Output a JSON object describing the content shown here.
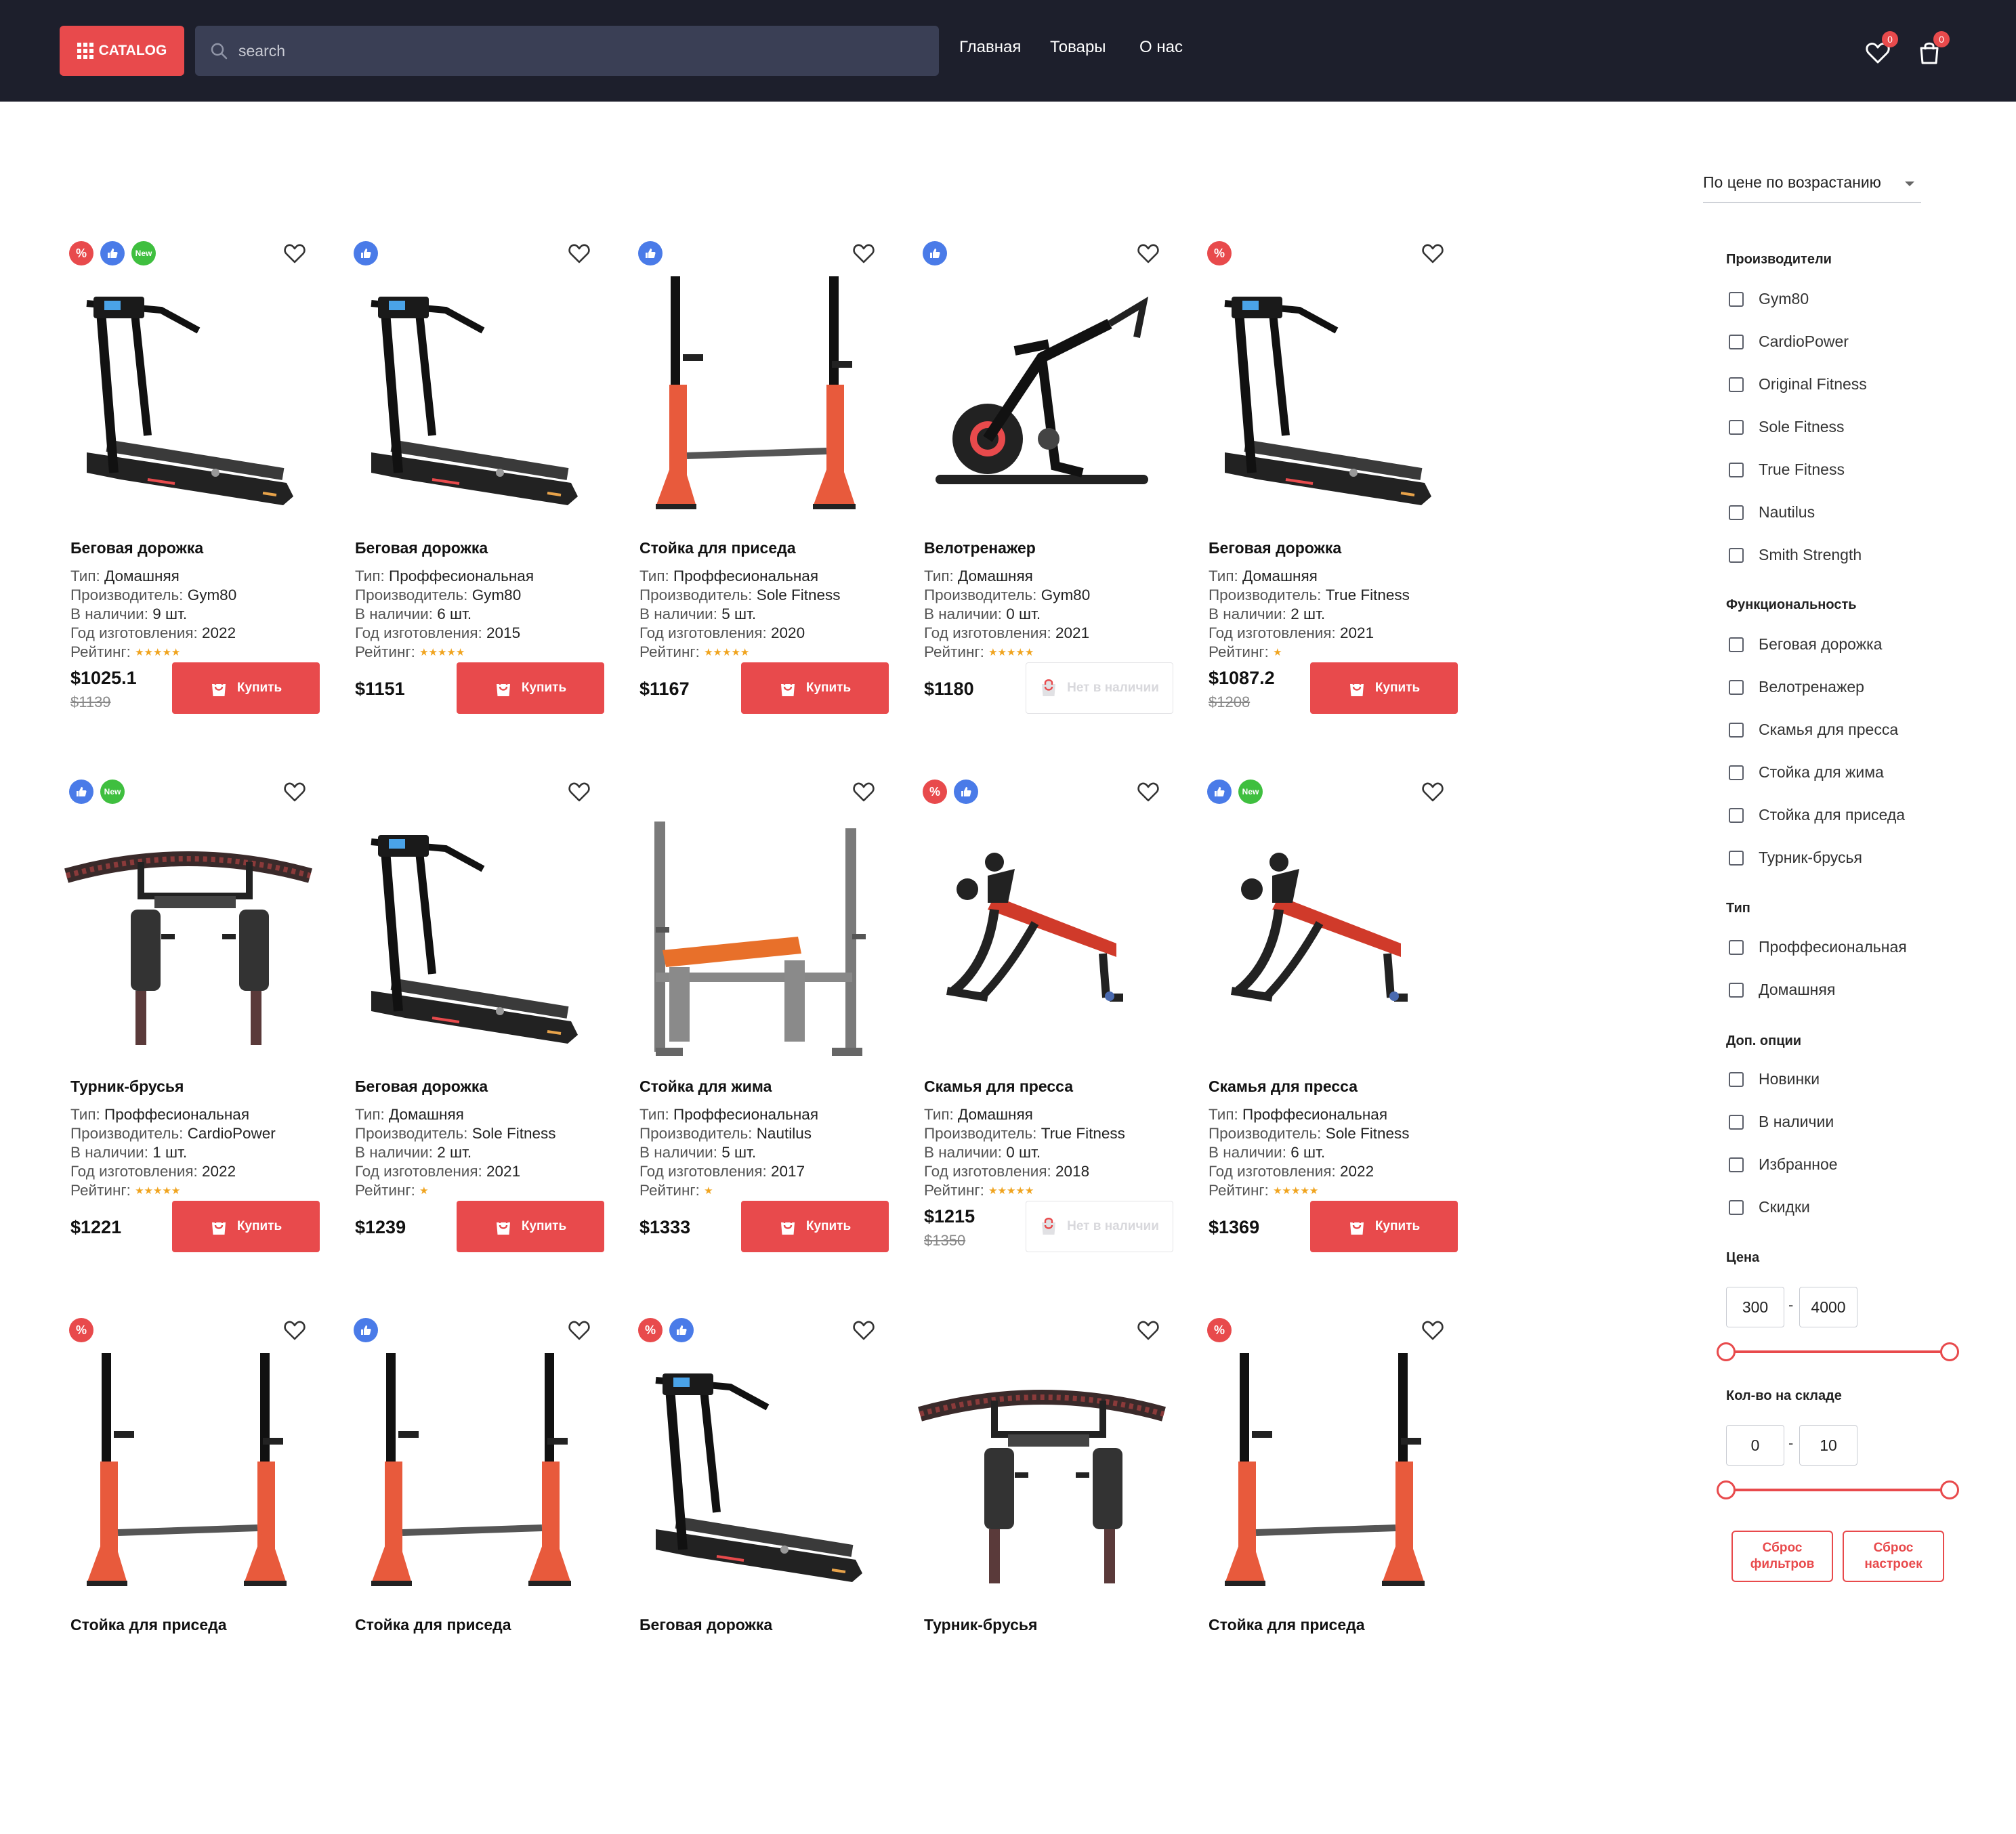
{
  "header": {
    "catalog_label": "CATALOG",
    "search_placeholder": "search",
    "nav": [
      "Главная",
      "Товары",
      "О нас"
    ],
    "favorites_count": "0",
    "cart_count": "0"
  },
  "sort": {
    "label": "По цене по возрастанию"
  },
  "filters": {
    "manufacturers_title": "Производители",
    "manufacturers": [
      "Gym80",
      "CardioPower",
      "Original Fitness",
      "Sole Fitness",
      "True Fitness",
      "Nautilus",
      "Smith Strength"
    ],
    "function_title": "Функциональность",
    "functions": [
      "Беговая дорожка",
      "Велотренажер",
      "Скамья для пресса",
      "Стойка для жима",
      "Стойка для приседа",
      "Турник-брусья"
    ],
    "type_title": "Тип",
    "types": [
      "Проффесиональная",
      "Домашняя"
    ],
    "extra_title": "Доп. опции",
    "extras": [
      "Новинки",
      "В наличии",
      "Избранное",
      "Скидки"
    ],
    "price_title": "Цена",
    "price_min": "300",
    "price_max": "4000",
    "stock_title": "Кол-во на складе",
    "stock_min": "0",
    "stock_max": "10",
    "reset_filters": "Сброс фильтров",
    "reset_settings": "Сброс настроек"
  },
  "labels": {
    "type": "Тип: ",
    "manufacturer": "Производитель: ",
    "in_stock": "В наличии: ",
    "year": "Год изготовления: ",
    "rating": "Рейтинг: ",
    "buy": "Купить",
    "out_of_stock": "Нет в наличии",
    "new_badge": "New",
    "sale_badge": "%"
  },
  "products": [
    {
      "title": "Беговая дорожка",
      "type": "Домашняя",
      "manufacturer": "Gym80",
      "stock": "9 шт.",
      "year": "2022",
      "rating": 5,
      "price": "$1025.1",
      "old_price": "$1139",
      "available": true,
      "badges": [
        "sale",
        "like",
        "new"
      ],
      "image": "treadmill"
    },
    {
      "title": "Беговая дорожка",
      "type": "Проффесиональная",
      "manufacturer": "Gym80",
      "stock": "6 шт.",
      "year": "2015",
      "rating": 5,
      "price": "$1151",
      "old_price": "",
      "available": true,
      "badges": [
        "like"
      ],
      "image": "treadmill"
    },
    {
      "title": "Стойка для приседа",
      "type": "Проффесиональная",
      "manufacturer": "Sole Fitness",
      "stock": "5 шт.",
      "year": "2020",
      "rating": 5,
      "price": "$1167",
      "old_price": "",
      "available": true,
      "badges": [
        "like"
      ],
      "image": "rack"
    },
    {
      "title": "Велотренажер",
      "type": "Домашняя",
      "manufacturer": "Gym80",
      "stock": "0 шт.",
      "year": "2021",
      "rating": 5,
      "price": "$1180",
      "old_price": "",
      "available": false,
      "badges": [
        "like"
      ],
      "image": "bike"
    },
    {
      "title": "Беговая дорожка",
      "type": "Домашняя",
      "manufacturer": "True Fitness",
      "stock": "2 шт.",
      "year": "2021",
      "rating": 1,
      "price": "$1087.2",
      "old_price": "$1208",
      "available": true,
      "badges": [
        "sale"
      ],
      "image": "treadmill"
    },
    {
      "title": "Турник-брусья",
      "type": "Проффесиональная",
      "manufacturer": "CardioPower",
      "stock": "1 шт.",
      "year": "2022",
      "rating": 5,
      "price": "$1221",
      "old_price": "",
      "available": true,
      "badges": [
        "like",
        "new"
      ],
      "image": "pullup"
    },
    {
      "title": "Беговая дорожка",
      "type": "Домашняя",
      "manufacturer": "Sole Fitness",
      "stock": "2 шт.",
      "year": "2021",
      "rating": 1,
      "price": "$1239",
      "old_price": "",
      "available": true,
      "badges": [],
      "image": "treadmill"
    },
    {
      "title": "Стойка для жима",
      "type": "Проффесиональная",
      "manufacturer": "Nautilus",
      "stock": "5 шт.",
      "year": "2017",
      "rating": 1,
      "price": "$1333",
      "old_price": "",
      "available": true,
      "badges": [],
      "image": "bench"
    },
    {
      "title": "Скамья для пресса",
      "type": "Домашняя",
      "manufacturer": "True Fitness",
      "stock": "0 шт.",
      "year": "2018",
      "rating": 5,
      "price": "$1215",
      "old_price": "$1350",
      "available": false,
      "badges": [
        "sale",
        "like"
      ],
      "image": "abbench"
    },
    {
      "title": "Скамья для пресса",
      "type": "Проффесиональная",
      "manufacturer": "Sole Fitness",
      "stock": "6 шт.",
      "year": "2022",
      "rating": 5,
      "price": "$1369",
      "old_price": "",
      "available": true,
      "badges": [
        "like",
        "new"
      ],
      "image": "abbench"
    },
    {
      "title": "Стойка для приседа",
      "badges": [
        "sale"
      ],
      "image": "rack"
    },
    {
      "title": "Стойка для приседа",
      "badges": [
        "like"
      ],
      "image": "rack"
    },
    {
      "title": "Беговая дорожка",
      "badges": [
        "sale",
        "like"
      ],
      "image": "treadmill"
    },
    {
      "title": "Турник-брусья",
      "badges": [],
      "image": "pullup"
    },
    {
      "title": "Стойка для приседа",
      "badges": [
        "sale"
      ],
      "image": "rack"
    }
  ]
}
